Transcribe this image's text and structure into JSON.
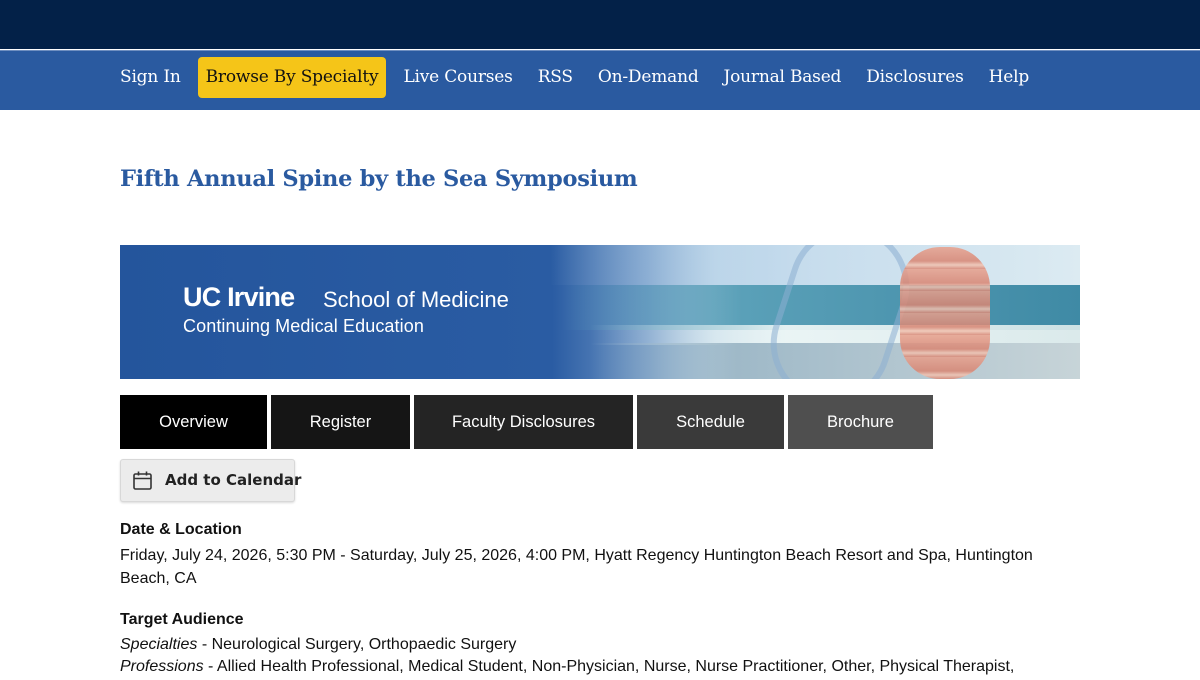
{
  "nav": {
    "items": [
      {
        "label": "Sign In",
        "active": false
      },
      {
        "label": "Browse By Specialty",
        "active": true
      },
      {
        "label": "Live Courses",
        "active": false
      },
      {
        "label": "RSS",
        "active": false
      },
      {
        "label": "On-Demand",
        "active": false
      },
      {
        "label": "Journal Based",
        "active": false
      },
      {
        "label": "Disclosures",
        "active": false
      },
      {
        "label": "Help",
        "active": false
      }
    ]
  },
  "page": {
    "title": "Fifth Annual Spine by the Sea Symposium"
  },
  "banner": {
    "logo_uc": "UC Irvine",
    "logo_school": "School of Medicine",
    "logo_cme": "Continuing Medical Education"
  },
  "tabs": [
    {
      "label": "Overview"
    },
    {
      "label": "Register"
    },
    {
      "label": "Faculty Disclosures"
    },
    {
      "label": "Schedule"
    },
    {
      "label": "Brochure"
    }
  ],
  "calendar_button": {
    "label": "Add to Calendar",
    "icon": "calendar-icon"
  },
  "date_location": {
    "heading": "Date & Location",
    "text": "Friday, July 24, 2026, 5:30 PM - Saturday, July 25, 2026, 4:00 PM, Hyatt Regency Huntington Beach Resort and Spa, Huntington Beach, CA"
  },
  "target_audience": {
    "heading": "Target Audience",
    "specialties_label": "Specialties",
    "specialties_value": " - Neurological Surgery, Orthopaedic Surgery",
    "professions_label": "Professions",
    "professions_value": " - Allied Health Professional, Medical Student, Non-Physician, Nurse, Nurse Practitioner, Other, Physical Therapist,"
  },
  "colors": {
    "top_bar": "#032148",
    "nav_bar": "#2a5aa0",
    "active_nav": "#f5c518",
    "title": "#2a5aa0"
  }
}
